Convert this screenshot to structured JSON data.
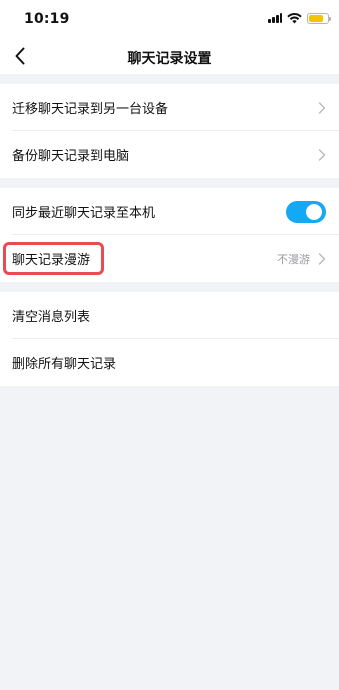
{
  "status_bar": {
    "time": "10:19",
    "battery_level": 0.8,
    "battery_color": "#f5c400"
  },
  "nav": {
    "title": "聊天记录设置",
    "back_icon": "chevron-left-icon"
  },
  "groups": [
    {
      "items": [
        {
          "label": "迁移聊天记录到另一台设备",
          "value": "",
          "control": "chevron"
        },
        {
          "label": "备份聊天记录到电脑",
          "value": "",
          "control": "chevron"
        }
      ]
    },
    {
      "items": [
        {
          "label": "同步最近聊天记录至本机",
          "value": "",
          "control": "toggle",
          "toggle_on": true
        },
        {
          "label": "聊天记录漫游",
          "value": "不漫游",
          "control": "chevron",
          "highlighted": true
        }
      ]
    },
    {
      "items": [
        {
          "label": "清空消息列表",
          "value": "",
          "control": "none"
        },
        {
          "label": "删除所有聊天记录",
          "value": "",
          "control": "none"
        }
      ]
    }
  ],
  "colors": {
    "accent": "#15a8f4",
    "highlight": "#ea4a52",
    "background": "#f2f3f7"
  }
}
